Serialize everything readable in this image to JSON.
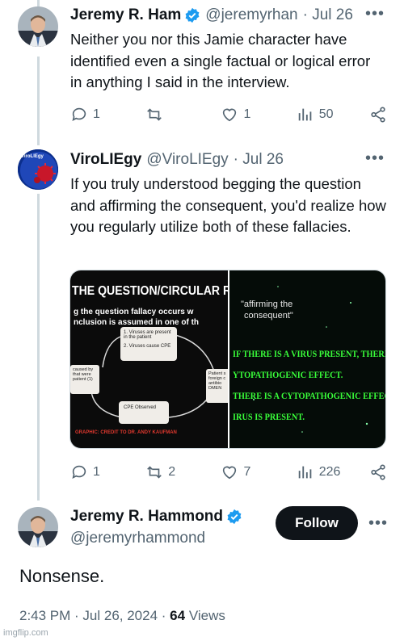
{
  "tweet1": {
    "name": "Jeremy R. Ham",
    "handle": "@jeremyrhan",
    "date": "· Jul 26",
    "text": "Neither you nor this Jamie character have identified even a single factual or logical error in anything I said in the interview.",
    "replies": "1",
    "retweets": "",
    "likes": "1",
    "views": "50"
  },
  "tweet2": {
    "name": "ViroLIEgy",
    "avatar_text": "ViroLIEgy",
    "handle": "@ViroLIEgy",
    "date": "· Jul 26",
    "text": "If you truly understood begging the question and affirming the consequent, you'd realize how you regularly utilize both of these fallacies.",
    "replies": "1",
    "retweets": "2",
    "likes": "7",
    "views": "226",
    "media_left": {
      "title": "THE QUESTION/CIRCULAR RE",
      "line1": "g the question fallacy occurs w",
      "line2": "nclusion is assumed in one of th",
      "box1a": "1. Viruses are present in the patient",
      "box1b": "2. Viruses cause CPE",
      "box_left": "caused by that were patient (1)",
      "box_right": "Patient s foreign c antibio DMEN",
      "box_bottom": "CPE Observed",
      "credit": "GRAPHIC: CREDIT TO DR. ANDY KAUFMAN"
    },
    "media_right": {
      "caption1": "\"affirming the",
      "caption2": "consequent\"",
      "line1": "IF THERE IS A VIRUS PRESENT, THERE WIL",
      "line2": "YTOPATHOGENIC EFFECT.",
      "line3": "THERE IS A CYTOPATHOGENIC EFFECT. TH",
      "line4": "IRUS IS PRESENT."
    }
  },
  "tweet3": {
    "name": "Jeremy R. Hammond",
    "handle": "@jeremyrhammond",
    "follow_label": "Follow",
    "text": "Nonsense.",
    "time": "2:43 PM · Jul 26, 2024 ·",
    "views_count": "64",
    "views_label": "Views"
  },
  "watermark": "imgflip.com",
  "colors": {
    "verified": "#1d9bf0",
    "secondary_text": "#536471",
    "follow_bg": "#0f1419",
    "neon_green": "#39ff3a"
  }
}
